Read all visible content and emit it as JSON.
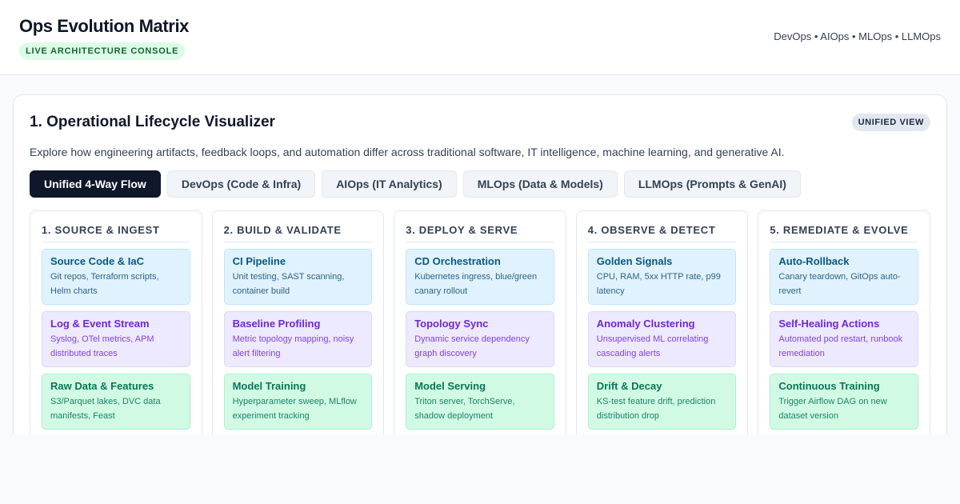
{
  "header": {
    "title": "Ops Evolution Matrix",
    "badge": "LIVE ARCHITECTURE CONSOLE",
    "ops_list": "DevOps • AIOps • MLOps • LLMOps"
  },
  "panel": {
    "title": "1. Operational Lifecycle Visualizer",
    "badge": "UNIFIED VIEW",
    "description": "Explore how engineering artifacts, feedback loops, and automation differ across traditional software, IT intelligence, machine learning, and generative AI.",
    "tabs": [
      {
        "label": "Unified 4-Way Flow",
        "active": true
      },
      {
        "label": "DevOps (Code & Infra)",
        "active": false
      },
      {
        "label": "AIOps (IT Analytics)",
        "active": false
      },
      {
        "label": "MLOps (Data & Models)",
        "active": false
      },
      {
        "label": "LLMOps (Prompts & GenAI)",
        "active": false
      }
    ],
    "stages": [
      {
        "title": "1. SOURCE & INGEST",
        "cards": [
          {
            "title": "Source Code & IaC",
            "desc": "Git repos, Terraform scripts, Helm charts"
          },
          {
            "title": "Log & Event Stream",
            "desc": "Syslog, OTel metrics, APM distributed traces"
          },
          {
            "title": "Raw Data & Features",
            "desc": "S3/Parquet lakes, DVC data manifests, Feast"
          }
        ]
      },
      {
        "title": "2. BUILD & VALIDATE",
        "cards": [
          {
            "title": "CI Pipeline",
            "desc": "Unit testing, SAST scanning, container build"
          },
          {
            "title": "Baseline Profiling",
            "desc": "Metric topology mapping, noisy alert filtering"
          },
          {
            "title": "Model Training",
            "desc": "Hyperparameter sweep, MLflow experiment tracking"
          }
        ]
      },
      {
        "title": "3. DEPLOY & SERVE",
        "cards": [
          {
            "title": "CD Orchestration",
            "desc": "Kubernetes ingress, blue/green canary rollout"
          },
          {
            "title": "Topology Sync",
            "desc": "Dynamic service dependency graph discovery"
          },
          {
            "title": "Model Serving",
            "desc": "Triton server, TorchServe, shadow deployment"
          }
        ]
      },
      {
        "title": "4. OBSERVE & DETECT",
        "cards": [
          {
            "title": "Golden Signals",
            "desc": "CPU, RAM, 5xx HTTP rate, p99 latency"
          },
          {
            "title": "Anomaly Clustering",
            "desc": "Unsupervised ML correlating cascading alerts"
          },
          {
            "title": "Drift & Decay",
            "desc": "KS-test feature drift, prediction distribution drop"
          }
        ]
      },
      {
        "title": "5. REMEDIATE & EVOLVE",
        "cards": [
          {
            "title": "Auto-Rollback",
            "desc": "Canary teardown, GitOps auto-revert"
          },
          {
            "title": "Self-Healing Actions",
            "desc": "Automated pod restart, runbook remediation"
          },
          {
            "title": "Continuous Training",
            "desc": "Trigger Airflow DAG on new dataset version"
          }
        ]
      }
    ]
  }
}
